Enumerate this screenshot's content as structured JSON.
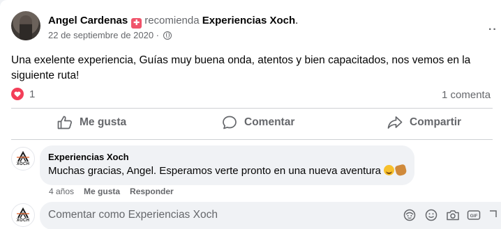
{
  "post": {
    "author": "Angel Cardenas",
    "action": "recomienda",
    "page": "Experiencias Xoch",
    "period": ".",
    "date": "22 de septiembre de 2020",
    "separator": " · ",
    "privacy_icon": "globe-icon",
    "text": "Una exelente experiencia, Guías muy buena onda, atentos y bien capacitados, nos vemos en la siguiente ruta!",
    "reaction_icon": "heart-icon",
    "reaction_count": "1",
    "comments_count": "1 comenta"
  },
  "actions": {
    "like": "Me gusta",
    "comment": "Comentar",
    "share": "Compartir"
  },
  "comment": {
    "avatar_text": "XOCH",
    "author": "Experiencias Xoch",
    "text": "Muchas gracias, Angel. Esperamos verte pronto en una nueva aventura",
    "time": "4 años",
    "like": "Me gusta",
    "reply": "Responder"
  },
  "composer": {
    "avatar_text": "XOCH",
    "placeholder": "Comentar como Experiencias Xoch",
    "tools": [
      "avatar-sticker-icon",
      "emoji-icon",
      "camera-icon",
      "gif-icon",
      "sticker-icon"
    ]
  },
  "colors": {
    "heart": "#f33e58",
    "recommend_badge": "#f0546b",
    "muted_text": "#65676b",
    "bubble_bg": "#f0f2f5"
  }
}
